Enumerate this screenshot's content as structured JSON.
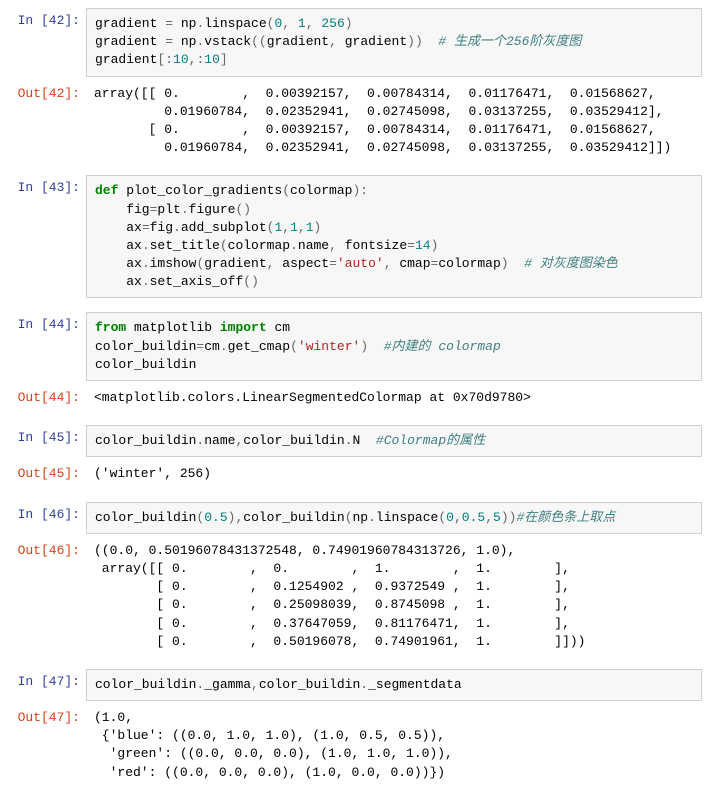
{
  "cells": [
    {
      "n": 42,
      "input_tokens": [
        [
          "",
          "gradient "
        ],
        [
          "op",
          "="
        ],
        [
          "",
          " np"
        ],
        [
          "op",
          "."
        ],
        [
          "",
          "linspace"
        ],
        [
          "op",
          "("
        ],
        [
          "num",
          "0"
        ],
        [
          "op",
          ","
        ],
        [
          "",
          " "
        ],
        [
          "num",
          "1"
        ],
        [
          "op",
          ","
        ],
        [
          "",
          " "
        ],
        [
          "num",
          "256"
        ],
        [
          "op",
          ")"
        ],
        "\n",
        [
          "",
          "gradient "
        ],
        [
          "op",
          "="
        ],
        [
          "",
          " np"
        ],
        [
          "op",
          "."
        ],
        [
          "",
          "vstack"
        ],
        [
          "op",
          "("
        ],
        [
          "op",
          "("
        ],
        [
          "",
          "gradient"
        ],
        [
          "op",
          ","
        ],
        [
          "",
          " gradient"
        ],
        [
          "op",
          ")"
        ],
        [
          "op",
          ")"
        ],
        [
          "",
          "  "
        ],
        [
          "cmt",
          "# 生成一个256阶灰度图"
        ],
        "\n",
        [
          "",
          "gradient"
        ],
        [
          "op",
          "["
        ],
        [
          "op",
          ":"
        ],
        [
          "num",
          "10"
        ],
        [
          "op",
          ","
        ],
        [
          "op",
          ":"
        ],
        [
          "num",
          "10"
        ],
        [
          "op",
          "]"
        ]
      ],
      "output": "array([[ 0.        ,  0.00392157,  0.00784314,  0.01176471,  0.01568627,\n         0.01960784,  0.02352941,  0.02745098,  0.03137255,  0.03529412],\n       [ 0.        ,  0.00392157,  0.00784314,  0.01176471,  0.01568627,\n         0.01960784,  0.02352941,  0.02745098,  0.03137255,  0.03529412]])"
    },
    {
      "n": 43,
      "input_tokens": [
        [
          "kw",
          "def"
        ],
        [
          "",
          " plot_color_gradients"
        ],
        [
          "op",
          "("
        ],
        [
          "",
          "colormap"
        ],
        [
          "op",
          ")"
        ],
        [
          "op",
          ":"
        ],
        "\n",
        [
          "",
          "    fig"
        ],
        [
          "op",
          "="
        ],
        [
          "",
          "plt"
        ],
        [
          "op",
          "."
        ],
        [
          "",
          "figure"
        ],
        [
          "op",
          "("
        ],
        [
          "op",
          ")"
        ],
        "\n",
        [
          "",
          "    ax"
        ],
        [
          "op",
          "="
        ],
        [
          "",
          "fig"
        ],
        [
          "op",
          "."
        ],
        [
          "",
          "add_subplot"
        ],
        [
          "op",
          "("
        ],
        [
          "num",
          "1"
        ],
        [
          "op",
          ","
        ],
        [
          "num",
          "1"
        ],
        [
          "op",
          ","
        ],
        [
          "num",
          "1"
        ],
        [
          "op",
          ")"
        ],
        "\n",
        [
          "",
          "    ax"
        ],
        [
          "op",
          "."
        ],
        [
          "",
          "set_title"
        ],
        [
          "op",
          "("
        ],
        [
          "",
          "colormap"
        ],
        [
          "op",
          "."
        ],
        [
          "",
          "name"
        ],
        [
          "op",
          ","
        ],
        [
          "",
          " fontsize"
        ],
        [
          "op",
          "="
        ],
        [
          "num",
          "14"
        ],
        [
          "op",
          ")"
        ],
        "\n",
        [
          "",
          "    ax"
        ],
        [
          "op",
          "."
        ],
        [
          "",
          "imshow"
        ],
        [
          "op",
          "("
        ],
        [
          "",
          "gradient"
        ],
        [
          "op",
          ","
        ],
        [
          "",
          " aspect"
        ],
        [
          "op",
          "="
        ],
        [
          "str",
          "'auto'"
        ],
        [
          "op",
          ","
        ],
        [
          "",
          " cmap"
        ],
        [
          "op",
          "="
        ],
        [
          "",
          "colormap"
        ],
        [
          "op",
          ")"
        ],
        [
          "",
          "  "
        ],
        [
          "cmt",
          "# 对灰度图染色"
        ],
        "\n",
        [
          "",
          "    ax"
        ],
        [
          "op",
          "."
        ],
        [
          "",
          "set_axis_off"
        ],
        [
          "op",
          "("
        ],
        [
          "op",
          ")"
        ]
      ],
      "output": null
    },
    {
      "n": 44,
      "input_tokens": [
        [
          "kw",
          "from"
        ],
        [
          "",
          " matplotlib "
        ],
        [
          "kw",
          "import"
        ],
        [
          "",
          " cm"
        ],
        "\n",
        [
          "",
          "color_buildin"
        ],
        [
          "op",
          "="
        ],
        [
          "",
          "cm"
        ],
        [
          "op",
          "."
        ],
        [
          "",
          "get_cmap"
        ],
        [
          "op",
          "("
        ],
        [
          "str",
          "'winter'"
        ],
        [
          "op",
          ")"
        ],
        [
          "",
          "  "
        ],
        [
          "cmt",
          "#内建的 colormap"
        ],
        "\n",
        [
          "",
          "color_buildin"
        ]
      ],
      "output": "<matplotlib.colors.LinearSegmentedColormap at 0x70d9780>"
    },
    {
      "n": 45,
      "input_tokens": [
        [
          "",
          "color_buildin"
        ],
        [
          "op",
          "."
        ],
        [
          "",
          "name"
        ],
        [
          "op",
          ","
        ],
        [
          "",
          "color_buildin"
        ],
        [
          "op",
          "."
        ],
        [
          "",
          "N  "
        ],
        [
          "cmt",
          "#Colormap的属性"
        ]
      ],
      "output": "('winter', 256)"
    },
    {
      "n": 46,
      "input_tokens": [
        [
          "",
          "color_buildin"
        ],
        [
          "op",
          "("
        ],
        [
          "num",
          "0.5"
        ],
        [
          "op",
          ")"
        ],
        [
          "op",
          ","
        ],
        [
          "",
          "color_buildin"
        ],
        [
          "op",
          "("
        ],
        [
          "",
          "np"
        ],
        [
          "op",
          "."
        ],
        [
          "",
          "linspace"
        ],
        [
          "op",
          "("
        ],
        [
          "num",
          "0"
        ],
        [
          "op",
          ","
        ],
        [
          "num",
          "0.5"
        ],
        [
          "op",
          ","
        ],
        [
          "num",
          "5"
        ],
        [
          "op",
          ")"
        ],
        [
          "op",
          ")"
        ],
        [
          "cmt",
          "#在颜色条上取点"
        ]
      ],
      "output": "((0.0, 0.50196078431372548, 0.74901960784313726, 1.0),\n array([[ 0.        ,  0.        ,  1.        ,  1.        ],\n        [ 0.        ,  0.1254902 ,  0.9372549 ,  1.        ],\n        [ 0.        ,  0.25098039,  0.8745098 ,  1.        ],\n        [ 0.        ,  0.37647059,  0.81176471,  1.        ],\n        [ 0.        ,  0.50196078,  0.74901961,  1.        ]]))"
    },
    {
      "n": 47,
      "input_tokens": [
        [
          "",
          "color_buildin"
        ],
        [
          "op",
          "."
        ],
        [
          "",
          "_gamma"
        ],
        [
          "op",
          ","
        ],
        [
          "",
          "color_buildin"
        ],
        [
          "op",
          "."
        ],
        [
          "",
          "_segmentdata"
        ]
      ],
      "output": "(1.0,\n {'blue': ((0.0, 1.0, 1.0), (1.0, 0.5, 0.5)),\n  'green': ((0.0, 0.0, 0.0), (1.0, 1.0, 1.0)),\n  'red': ((0.0, 0.0, 0.0), (1.0, 0.0, 0.0))})"
    }
  ]
}
